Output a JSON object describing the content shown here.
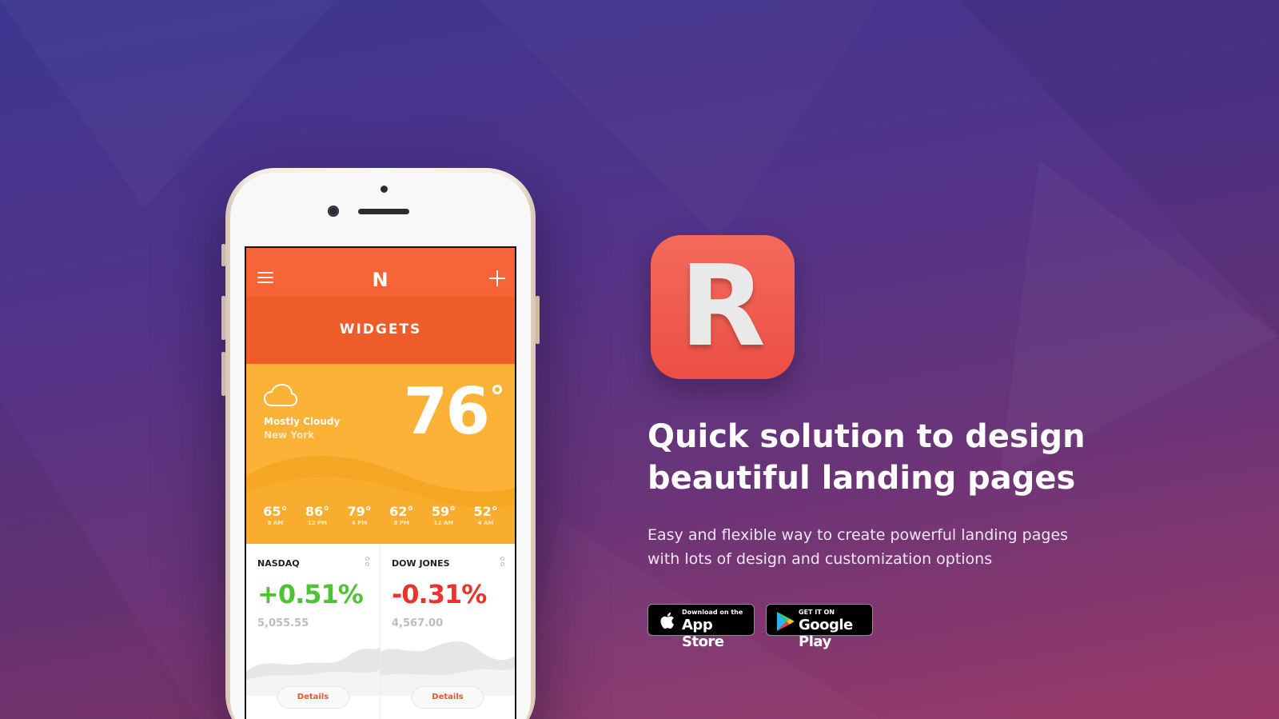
{
  "phone": {
    "app": {
      "brand_logo": "N",
      "menu_icon": "hamburger-menu-icon",
      "add_icon": "plus-icon",
      "title": "WIDGETS"
    },
    "weather": {
      "icon": "cloud-icon",
      "condition": "Mostly Cloudy",
      "city": "New York",
      "temperature": "76",
      "hourly": [
        {
          "temp": "65°",
          "time": "8 AM"
        },
        {
          "temp": "86°",
          "time": "12 PM"
        },
        {
          "temp": "79°",
          "time": "4 PM"
        },
        {
          "temp": "62°",
          "time": "8 PM"
        },
        {
          "temp": "59°",
          "time": "12 AM"
        },
        {
          "temp": "52°",
          "time": "4 AM"
        }
      ]
    },
    "stocks": [
      {
        "name": "NASDAQ",
        "change": "+0.51%",
        "value": "5,055.55",
        "color": "#4fc236",
        "details_label": "Details"
      },
      {
        "name": "DOW JONES",
        "change": "-0.31%",
        "value": "4,567.00",
        "color": "#e8352c",
        "details_label": "Details"
      }
    ]
  },
  "hero": {
    "app_icon_letter": "R",
    "headline_line1": "Quick solution to design",
    "headline_line2": "beautiful landing pages",
    "description": "Easy and flexible way to create powerful landing pages with lots of design and customization options",
    "app_store": {
      "small": "Download on the",
      "big": "App Store",
      "icon": "apple-icon"
    },
    "google_play": {
      "small": "GET IT ON",
      "big": "Google Play",
      "icon": "google-play-icon"
    }
  },
  "colors": {
    "header_orange": "#f3622f",
    "weather_yellow": "#fbb236",
    "app_icon_red": "#ec4f44",
    "bg_top": "#3c3690",
    "bg_bottom": "#9a3a66"
  }
}
